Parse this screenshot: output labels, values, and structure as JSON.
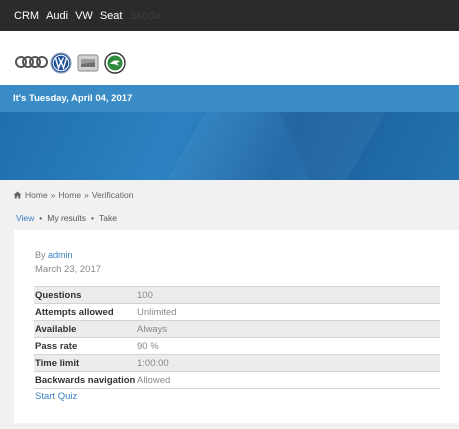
{
  "nav": {
    "items": [
      {
        "label": "CRM"
      },
      {
        "label": "Audi"
      },
      {
        "label": "VW"
      },
      {
        "label": "Seat"
      },
      {
        "label": "Skoda"
      }
    ]
  },
  "banner": {
    "date_text": "It's Tuesday, April 04, 2017"
  },
  "breadcrumb": {
    "icon": "home-icon",
    "items": [
      "Home",
      "Home",
      "Verification"
    ],
    "separator": "»"
  },
  "tabs": {
    "items": [
      "View",
      "My results",
      "Take"
    ],
    "separator": "•"
  },
  "quiz": {
    "by_prefix": "By",
    "author": "admin",
    "date": "March 23, 2017",
    "rows": [
      {
        "label": "Questions",
        "value": "100"
      },
      {
        "label": "Attempts allowed",
        "value": "Unlimited"
      },
      {
        "label": "Available",
        "value": "Always"
      },
      {
        "label": "Pass rate",
        "value": "90 %"
      },
      {
        "label": "Time limit",
        "value": "1:00:00"
      },
      {
        "label": "Backwards navigation",
        "value": "Allowed"
      }
    ],
    "start_label": "Start Quiz"
  },
  "colors": {
    "topbar": "#2b2b2b",
    "banner": "#3a8cc6",
    "link": "#3a7fc0"
  }
}
